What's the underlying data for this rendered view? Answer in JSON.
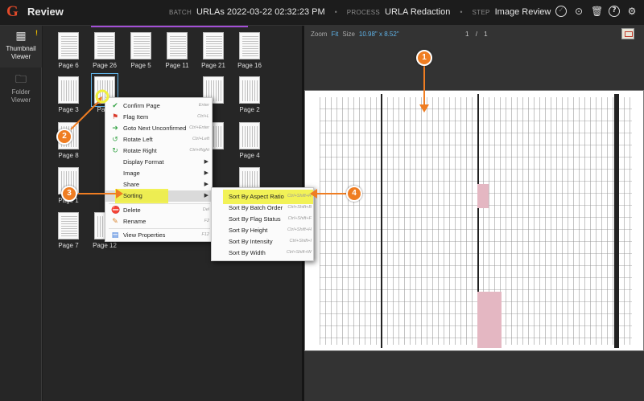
{
  "app": {
    "logo": "G",
    "title": "Review",
    "alert": "!"
  },
  "breadcrumb": {
    "batch_label": "BATCH",
    "batch_value": "URLAs 2022-03-22 02:32:23 PM",
    "process_label": "PROCESS",
    "process_value": "URLA Redaction",
    "step_label": "STEP",
    "step_value": "Image Review"
  },
  "top_icons": [
    "check-circle-icon",
    "lock-icon",
    "trash-icon",
    "help-icon",
    "settings-icon"
  ],
  "rail": {
    "thumbnail": {
      "label_line1": "Thumbnail",
      "label_line2": "Viewer"
    },
    "folder": {
      "label_line1": "Folder",
      "label_line2": "Viewer"
    }
  },
  "thumbnails": {
    "row1": [
      "Page 6",
      "Page 26",
      "Page 5",
      "Page 11",
      "Page 21",
      "Page 16"
    ],
    "row2": [
      "Page 3",
      "Page",
      "",
      "",
      "",
      "Page 2"
    ],
    "row3": [
      "Page 8",
      "",
      "",
      "",
      "",
      "Page 4"
    ],
    "row4": [
      "Page 1",
      "",
      "",
      "",
      "",
      "Page 12"
    ],
    "row5": [
      "Page 7",
      "Page 12"
    ]
  },
  "viewer": {
    "zoom_label": "Zoom",
    "zoom_value": "Fit",
    "size_label": "Size",
    "size_value": "10.98\" x 8.52\"",
    "page_current": "1",
    "page_sep": "/",
    "page_total": "1"
  },
  "context_menu": {
    "items": [
      {
        "label": "Confirm Page",
        "shortcut": "Enter",
        "icon": "check-icon",
        "color": "#3aa54a"
      },
      {
        "label": "Flag Item",
        "shortcut": "Ctrl+L",
        "icon": "flag-icon",
        "color": "#d93a2b"
      },
      {
        "label": "Goto Next Unconfirmed",
        "shortcut": "Ctrl+Enter",
        "icon": "next-icon",
        "color": "#3aa54a"
      },
      {
        "label": "Rotate Left",
        "shortcut": "Ctrl+Left",
        "icon": "rotate-left-icon",
        "color": "#3aa54a"
      },
      {
        "label": "Rotate Right",
        "shortcut": "Ctrl+Right",
        "icon": "rotate-right-icon",
        "color": "#3aa54a"
      },
      {
        "label": "Display Format",
        "arrow": "▶"
      },
      {
        "label": "Image",
        "arrow": "▶"
      },
      {
        "label": "Share",
        "arrow": "▶"
      },
      {
        "label": "Sorting",
        "arrow": "▶"
      },
      {
        "label": "Delete",
        "shortcut": "Del",
        "icon": "delete-icon",
        "color": "#d93a2b"
      },
      {
        "label": "Rename",
        "shortcut": "F2",
        "icon": "rename-icon",
        "color": "#d9822b"
      },
      {
        "label": "View Properties",
        "shortcut": "F12",
        "icon": "properties-icon",
        "color": "#2b6fd9"
      }
    ]
  },
  "sorting_submenu": {
    "items": [
      {
        "label": "Sort By Aspect Ratio",
        "shortcut": "Ctrl+Shift+R"
      },
      {
        "label": "Sort By Batch Order",
        "shortcut": "Ctrl+Shift+B"
      },
      {
        "label": "Sort By Flag Status",
        "shortcut": "Ctrl+Shift+F"
      },
      {
        "label": "Sort By Height",
        "shortcut": "Ctrl+Shift+H"
      },
      {
        "label": "Sort By Intensity",
        "shortcut": "Ctrl+Shift+I"
      },
      {
        "label": "Sort By Width",
        "shortcut": "Ctrl+Shift+W"
      }
    ]
  },
  "callouts": [
    "1",
    "2",
    "3",
    "4"
  ],
  "colors": {
    "accent": "#ef7d22",
    "highlight": "#f0f03a",
    "link": "#5fb3e8",
    "brand": "#e14a2a"
  }
}
